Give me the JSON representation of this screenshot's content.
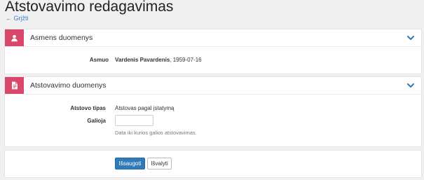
{
  "page": {
    "title": "Atstovavimo redagavimas",
    "back_link": "← Grįžti"
  },
  "panel_person": {
    "title": "Asmens duomenys",
    "icon": "user-icon",
    "icon_color": "#d9486a",
    "fields": {
      "asmuo_label": "Asmuo",
      "asmuo_name": "Vardenis Pavardenis",
      "asmuo_dob": ", 1959-07-16"
    }
  },
  "panel_representation": {
    "title": "Atstovavimo duomenys",
    "icon": "document-icon",
    "icon_color": "#d9486a",
    "fields": {
      "tipas_label": "Atstovo tipas",
      "tipas_value": "Atstovas pagal įstatymą",
      "galioja_label": "Galioja",
      "galioja_value": "",
      "galioja_help": "Data iki kurios galios atstovavimas."
    }
  },
  "actions": {
    "save_label": "Išsaugoti",
    "clear_label": "Išvalyti",
    "primary_color": "#2f7ab9"
  }
}
